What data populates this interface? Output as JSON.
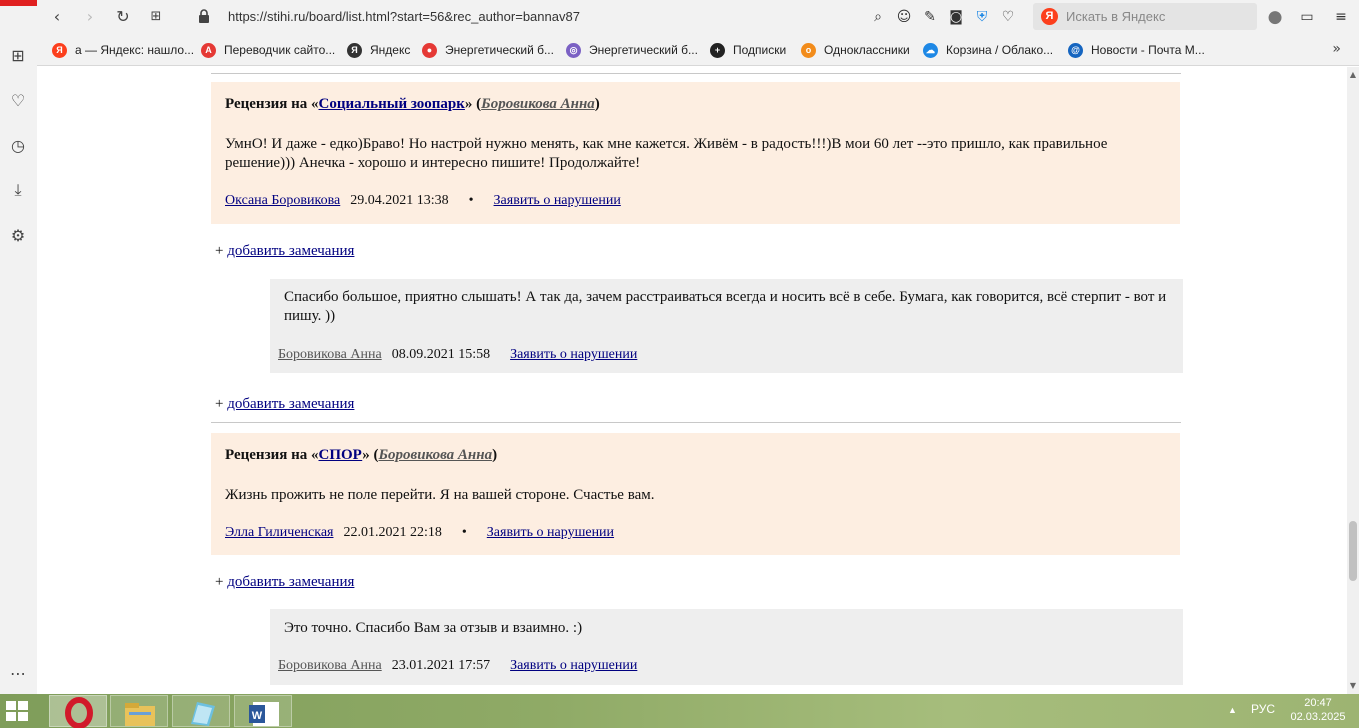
{
  "browser": {
    "url": "https://stihi.ru/board/list.html?start=56&rec_author=bannav87",
    "search_placeholder": "Искать в Яндекс",
    "search_logo": "Я"
  },
  "bookmarks": [
    {
      "label": "а — Яндекс: нашло...",
      "icon": "yandex-icon",
      "color": "#fc3f1d",
      "glyph": "Я"
    },
    {
      "label": "Переводчик сайто...",
      "icon": "translate-icon",
      "color": "#e53935",
      "glyph": "A"
    },
    {
      "label": "Яндекс",
      "icon": "yandex-icon",
      "color": "#333333",
      "glyph": "Я"
    },
    {
      "label": "Энергетический б...",
      "icon": "location-pin-icon",
      "color": "#e53935",
      "glyph": "●"
    },
    {
      "label": "Энергетический б...",
      "icon": "globe-icon",
      "color": "#7b61c4",
      "glyph": "◎"
    },
    {
      "label": "Подписки",
      "icon": "plus-icon",
      "color": "#222222",
      "glyph": "+"
    },
    {
      "label": "Одноклассники",
      "icon": "odnoklassniki-icon",
      "color": "#f28c1b",
      "glyph": "о"
    },
    {
      "label": "Корзина / Облако...",
      "icon": "cloud-icon",
      "color": "#1e88e5",
      "glyph": "☁"
    },
    {
      "label": "Новости - Почта М...",
      "icon": "mail-icon",
      "color": "#1565c0",
      "glyph": "@"
    }
  ],
  "reviews": [
    {
      "prefix": "Рецензия на «",
      "work": "Социальный зоопарк",
      "mid": "» (",
      "author": "Боровикова Анна",
      "suffix": ")",
      "text": "УмнО! И даже - едко)Браво! Но настрой нужно менять, как мне кажется. Живём - в радость!!!)В мои 60 лет --это пришло, как правильное решение))) Анечка - хорошо и интересно пишите! Продолжайте!",
      "reviewer": "Оксана Боровикова",
      "date": "29.04.2021 13:38",
      "bullet": "•",
      "report": "Заявить о нарушении"
    },
    {
      "prefix": "Рецензия на «",
      "work": "СПОР",
      "mid": "» (",
      "author": "Боровикова Анна",
      "suffix": ")",
      "text": "Жизнь прожить не поле перейти. Я на вашей стороне. Счастье вам.",
      "reviewer": "Элла Гиличенская",
      "date": "22.01.2021 22:18",
      "bullet": "•",
      "report": "Заявить о нарушении"
    }
  ],
  "replies": [
    {
      "text": "Спасибо большое, приятно слышать! А так да, зачем расстраиваться всегда и носить всё в себе. Бумага, как говорится, всё стерпит - вот и пишу. ))",
      "author": "Боровикова Анна",
      "date": "08.09.2021 15:58",
      "report": "Заявить о нарушении"
    },
    {
      "text": "Это точно. Спасибо Вам за отзыв и взаимно. :)",
      "author": "Боровикова Анна",
      "date": "23.01.2021 17:57",
      "report": "Заявить о нарушении"
    }
  ],
  "add_remark": {
    "plus": "+",
    "label": "добавить замечания"
  },
  "taskbar": {
    "language": "РУС",
    "time": "20:47",
    "date": "02.03.2025",
    "tray_arrow": "▲"
  }
}
